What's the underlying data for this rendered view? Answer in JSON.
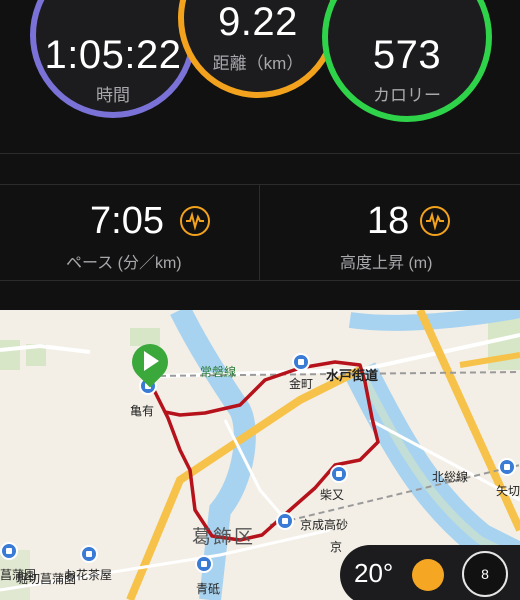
{
  "stats": {
    "time": {
      "value": "1:05:22",
      "label": "時間"
    },
    "distance": {
      "value": "9.22",
      "label": "距離（km）"
    },
    "calories": {
      "value": "573",
      "label": "カロリー"
    }
  },
  "metrics": {
    "pace": {
      "value": "7:05",
      "label": "ペース (分／km)",
      "icon": "pulse-icon"
    },
    "elevation": {
      "value": "18",
      "label": "高度上昇 (m)",
      "icon": "pulse-icon"
    }
  },
  "map": {
    "labels": {
      "jobansen": "常磐線",
      "kanamachi": "金町",
      "mitokaido": "水戸街道",
      "kameari": "亀有",
      "shibamata": "柴又",
      "hokusosen": "北総線",
      "yagiri": "矢切",
      "katsushika": "葛飾区",
      "keiseitakasago": "京成高砂",
      "aoto": "青砥",
      "kei": "京",
      "horikiri": "堀切菖蒲園",
      "ohanajaya": "お花茶屋",
      "shobu": "菖蒲園"
    }
  },
  "weather": {
    "temperature": "20°",
    "icon": "sun-icon",
    "compass_value": "8"
  },
  "colors": {
    "time_ring": "#7b72d8",
    "distance_ring": "#f2a21d",
    "calorie_ring": "#2fd34a",
    "route": "#b5121b"
  }
}
